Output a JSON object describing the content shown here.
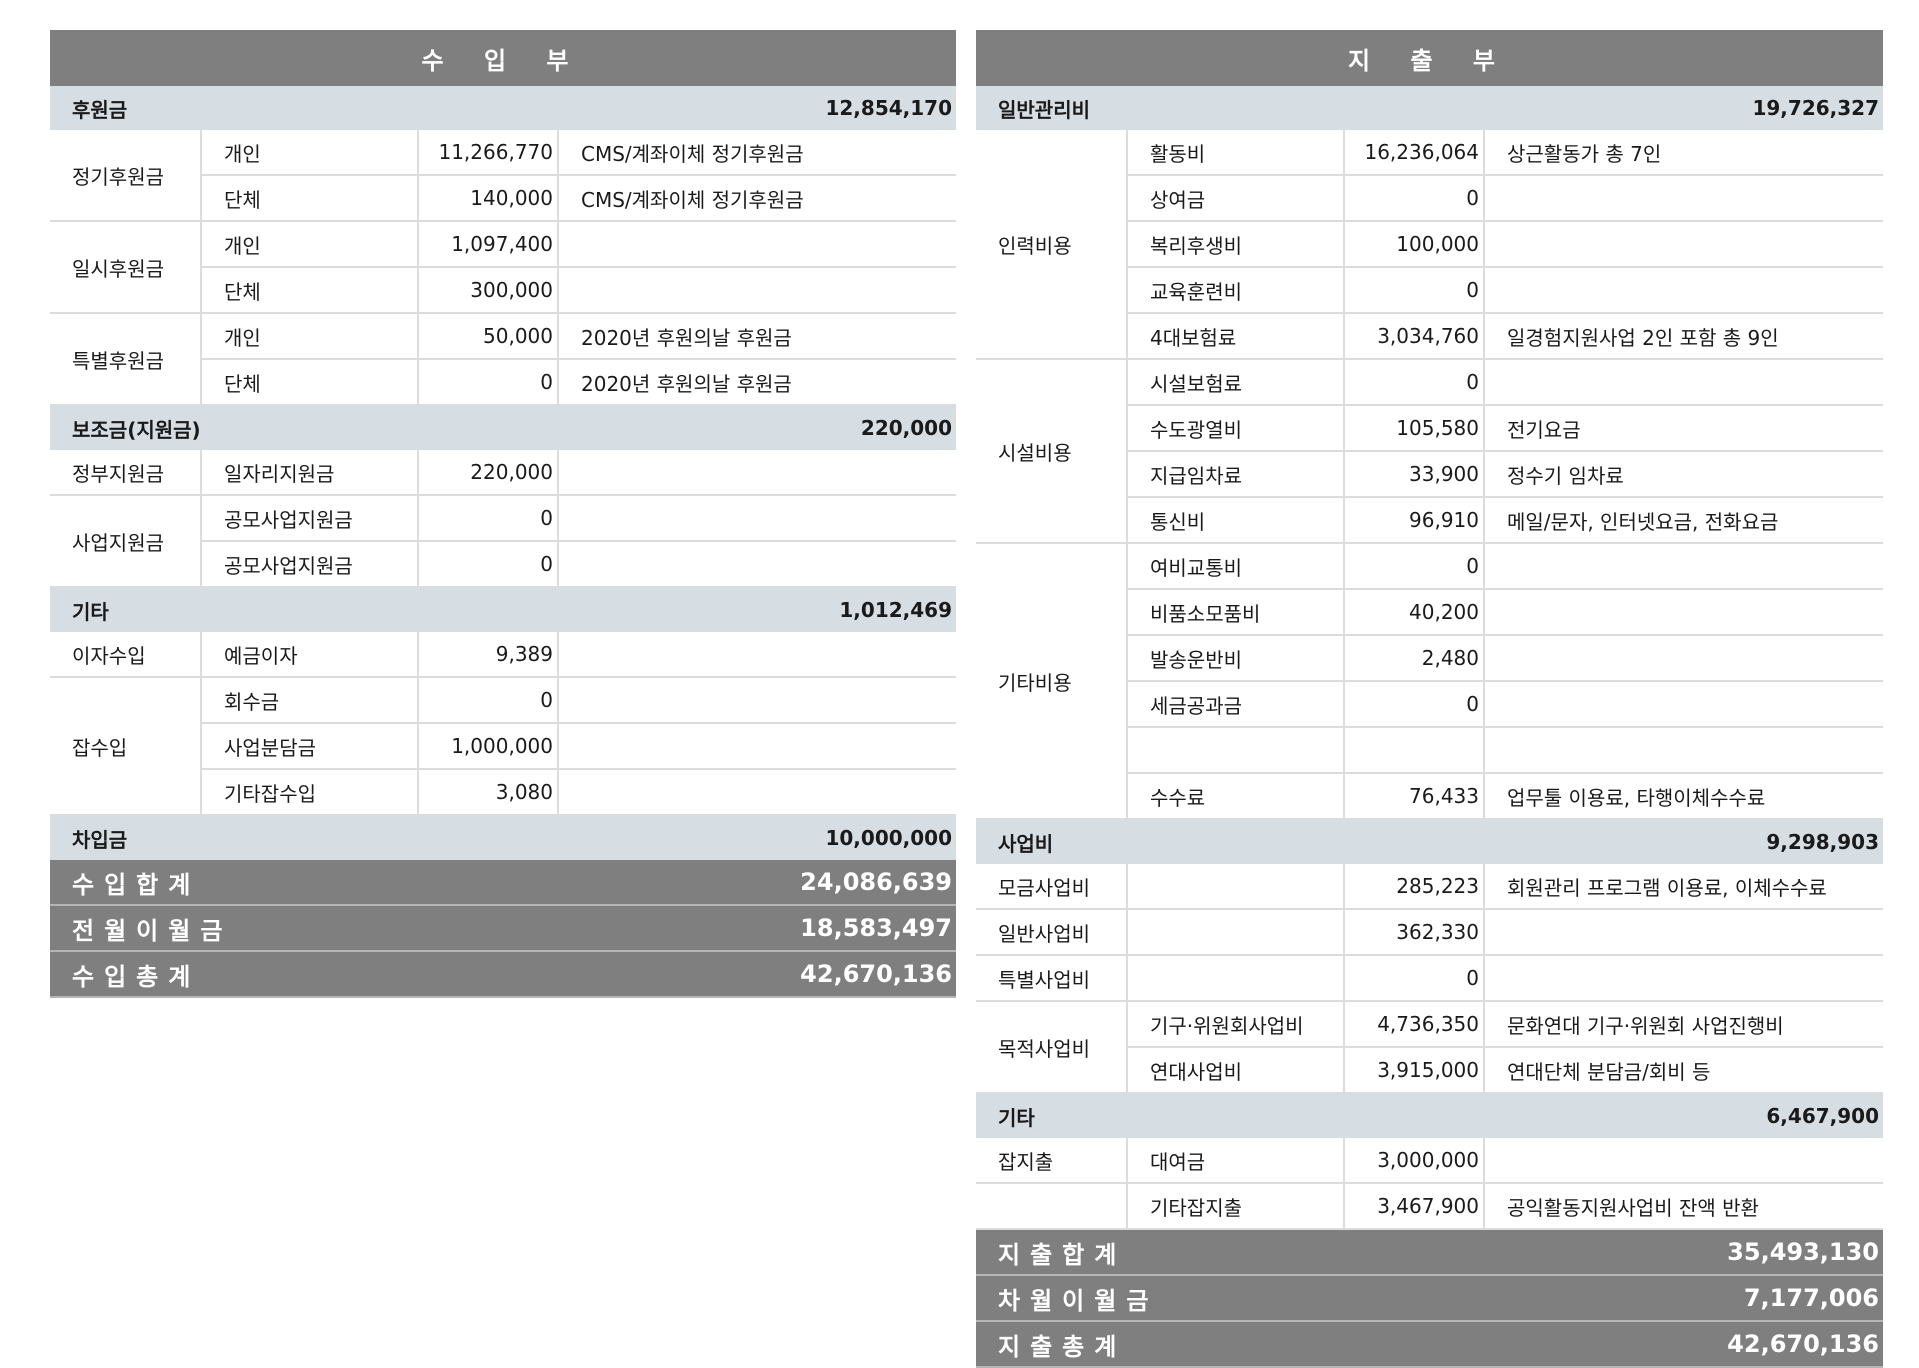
{
  "income": {
    "title": "수 입 부",
    "sections": [
      {
        "name": "후원금",
        "amount": "12,854,170",
        "groups": [
          {
            "category": "정기후원금",
            "rows": [
              {
                "item": "개인",
                "amount": "11,266,770",
                "note": "CMS/계좌이체 정기후원금"
              },
              {
                "item": "단체",
                "amount": "140,000",
                "note": "CMS/계좌이체 정기후원금"
              }
            ]
          },
          {
            "category": "일시후원금",
            "rows": [
              {
                "item": "개인",
                "amount": "1,097,400",
                "note": ""
              },
              {
                "item": "단체",
                "amount": "300,000",
                "note": ""
              }
            ]
          },
          {
            "category": "특별후원금",
            "rows": [
              {
                "item": "개인",
                "amount": "50,000",
                "note": "2020년 후원의날 후원금"
              },
              {
                "item": "단체",
                "amount": "0",
                "note": "2020년 후원의날 후원금"
              }
            ]
          }
        ]
      },
      {
        "name": "보조금(지원금)",
        "amount": "220,000",
        "groups": [
          {
            "category": "정부지원금",
            "rows": [
              {
                "item": "일자리지원금",
                "amount": "220,000",
                "note": ""
              }
            ]
          },
          {
            "category": "사업지원금",
            "rows": [
              {
                "item": "공모사업지원금",
                "amount": "0",
                "note": ""
              },
              {
                "item": "공모사업지원금",
                "amount": "0",
                "note": ""
              }
            ]
          }
        ]
      },
      {
        "name": "기타",
        "amount": "1,012,469",
        "groups": [
          {
            "category": "이자수입",
            "rows": [
              {
                "item": "예금이자",
                "amount": "9,389",
                "note": ""
              }
            ]
          },
          {
            "category": "잡수입",
            "rows": [
              {
                "item": "회수금",
                "amount": "0",
                "note": ""
              },
              {
                "item": "사업분담금",
                "amount": "1,000,000",
                "note": ""
              },
              {
                "item": "기타잡수입",
                "amount": "3,080",
                "note": ""
              }
            ]
          }
        ]
      },
      {
        "name": "차입금",
        "amount": "10,000,000",
        "groups": []
      }
    ],
    "totals": [
      {
        "label": "수입합계",
        "amount": "24,086,639"
      },
      {
        "label": "전월이월금",
        "amount": "18,583,497"
      },
      {
        "label": "수입총계",
        "amount": "42,670,136"
      }
    ]
  },
  "expense": {
    "title": "지 출 부",
    "sections": [
      {
        "name": "일반관리비",
        "amount": "19,726,327",
        "groups": [
          {
            "category": "인력비용",
            "rows": [
              {
                "item": "활동비",
                "amount": "16,236,064",
                "note": "상근활동가 총 7인"
              },
              {
                "item": "상여금",
                "amount": "0",
                "note": ""
              },
              {
                "item": "복리후생비",
                "amount": "100,000",
                "note": ""
              },
              {
                "item": "교육훈련비",
                "amount": "0",
                "note": ""
              },
              {
                "item": "4대보험료",
                "amount": "3,034,760",
                "note": "일경험지원사업 2인 포함 총 9인"
              }
            ]
          },
          {
            "category": "시설비용",
            "rows": [
              {
                "item": "시설보험료",
                "amount": "0",
                "note": ""
              },
              {
                "item": "수도광열비",
                "amount": "105,580",
                "note": "전기요금"
              },
              {
                "item": "지급임차료",
                "amount": "33,900",
                "note": "정수기 임차료"
              },
              {
                "item": "통신비",
                "amount": "96,910",
                "note": "메일/문자, 인터넷요금, 전화요금"
              }
            ]
          },
          {
            "category": "기타비용",
            "rows": [
              {
                "item": "여비교통비",
                "amount": "0",
                "note": ""
              },
              {
                "item": "비품소모품비",
                "amount": "40,200",
                "note": ""
              },
              {
                "item": "발송운반비",
                "amount": "2,480",
                "note": ""
              },
              {
                "item": "세금공과금",
                "amount": "0",
                "note": ""
              },
              {
                "item": "",
                "amount": "",
                "note": ""
              },
              {
                "item": "수수료",
                "amount": "76,433",
                "note": "업무툴 이용료, 타행이체수수료"
              }
            ]
          }
        ]
      },
      {
        "name": "사업비",
        "amount": "9,298,903",
        "groups": [
          {
            "category": "모금사업비",
            "rows": [
              {
                "item": "",
                "amount": "285,223",
                "note": "회원관리 프로그램 이용료, 이체수수료"
              }
            ]
          },
          {
            "category": "일반사업비",
            "rows": [
              {
                "item": "",
                "amount": "362,330",
                "note": ""
              }
            ]
          },
          {
            "category": "특별사업비",
            "rows": [
              {
                "item": "",
                "amount": "0",
                "note": ""
              }
            ]
          },
          {
            "category": "목적사업비",
            "rows": [
              {
                "item": "기구·위원회사업비",
                "amount": "4,736,350",
                "note": "문화연대 기구·위원회 사업진행비"
              },
              {
                "item": "연대사업비",
                "amount": "3,915,000",
                "note": "연대단체 분담금/회비 등"
              }
            ]
          }
        ]
      },
      {
        "name": "기타",
        "amount": "6,467,900",
        "groups": [
          {
            "category": "잡지출",
            "rows": [
              {
                "item": "대여금",
                "amount": "3,000,000",
                "note": ""
              }
            ]
          },
          {
            "category": "",
            "rows": [
              {
                "item": "기타잡지출",
                "amount": "3,467,900",
                "note": "공익활동지원사업비 잔액 반환"
              }
            ]
          }
        ]
      }
    ],
    "totals": [
      {
        "label": "지출합계",
        "amount": "35,493,130"
      },
      {
        "label": "차월이월금",
        "amount": "7,177,006"
      },
      {
        "label": "지출총계",
        "amount": "42,670,136"
      }
    ]
  }
}
